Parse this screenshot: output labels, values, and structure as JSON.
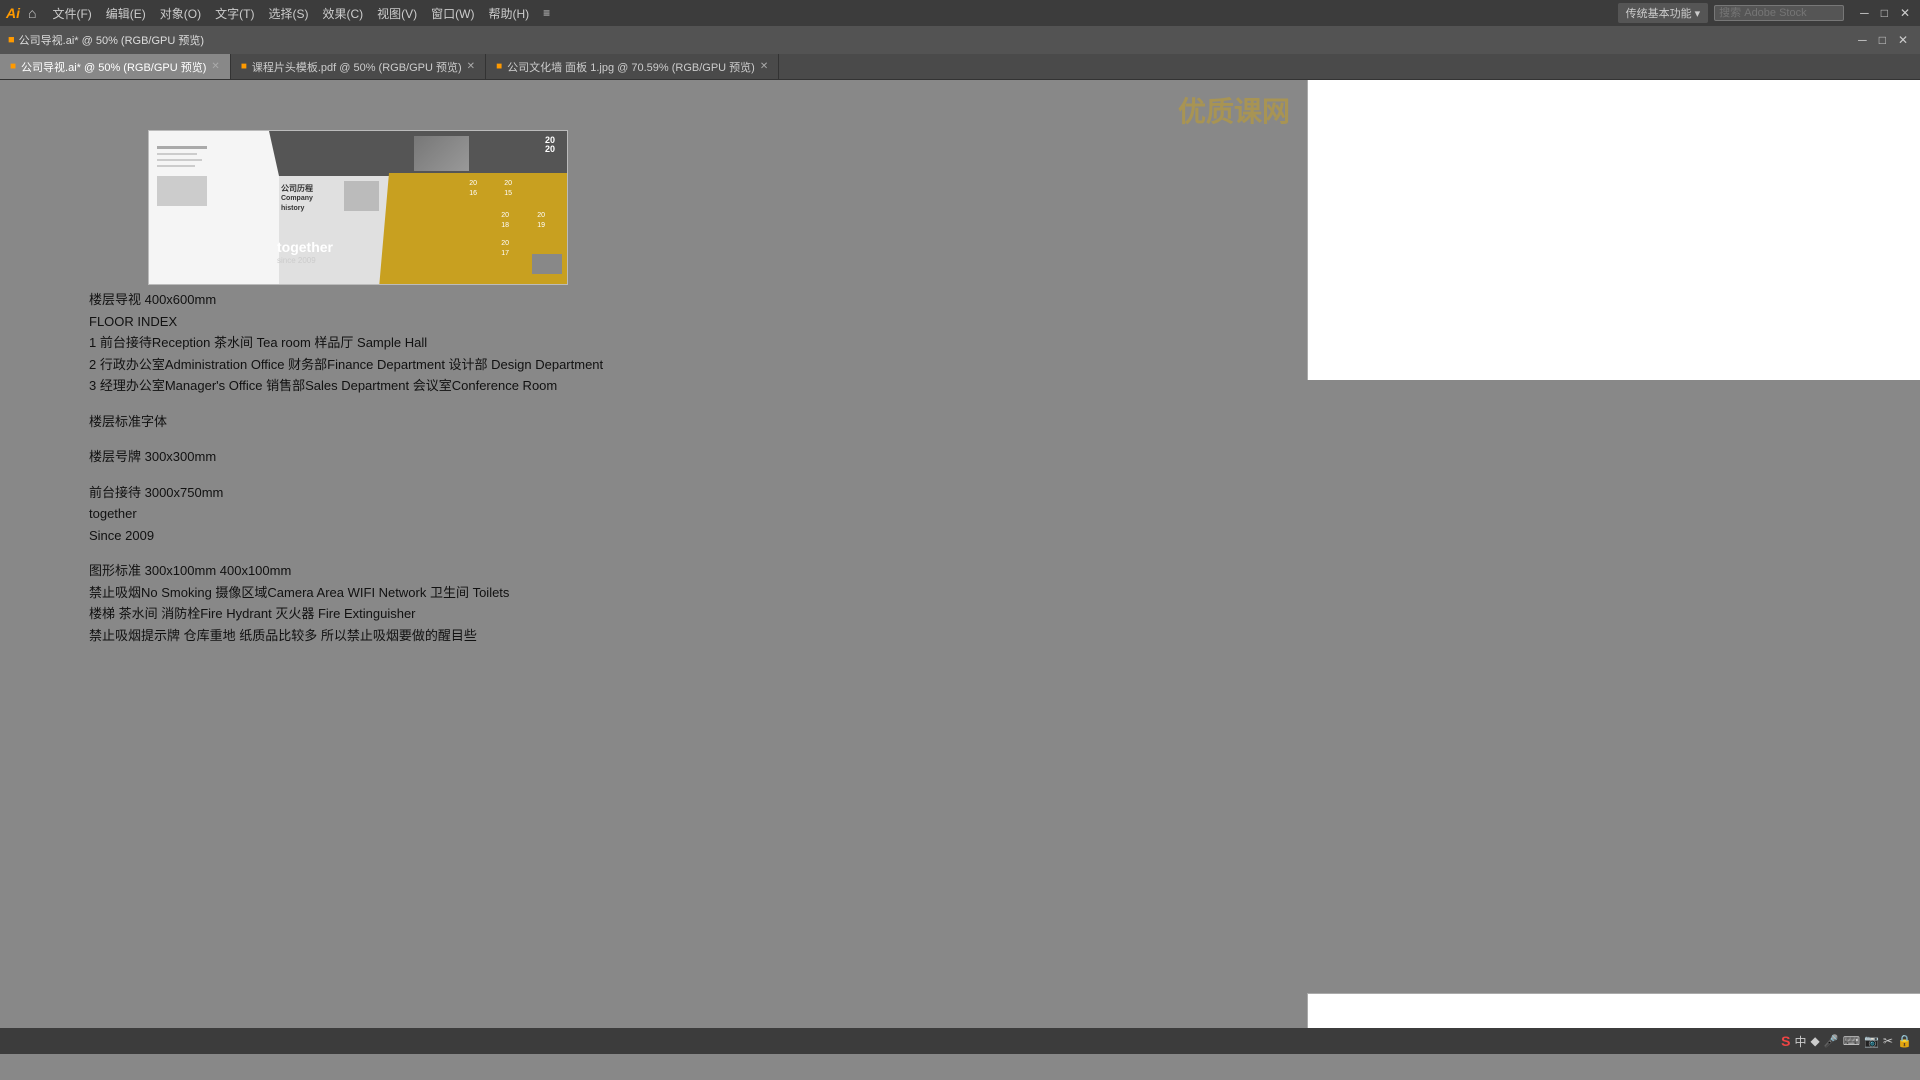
{
  "app": {
    "logo": "Ai",
    "home_icon": "⌂"
  },
  "menubar": {
    "items": [
      {
        "label": "文件(F)"
      },
      {
        "label": "编辑(E)"
      },
      {
        "label": "对象(O)"
      },
      {
        "label": "文字(T)"
      },
      {
        "label": "选择(S)"
      },
      {
        "label": "效果(C)"
      },
      {
        "label": "视图(V)"
      },
      {
        "label": "窗口(W)"
      },
      {
        "label": "帮助(H)"
      },
      {
        "label": "≡"
      }
    ],
    "top_right": {
      "chuantong": "传统基本功能 ▾",
      "search_placeholder": "搜索 Adobe Stock"
    }
  },
  "doc_titlebar": {
    "title": "公司导视.ai* @ 50% (RGB/GPU 预览)",
    "icon": "■"
  },
  "tabs": [
    {
      "label": "公司导视.ai* @ 50% (RGB/GPU 预览)",
      "active": true
    },
    {
      "label": "课程片头模板.pdf @ 50% (RGB/GPU 预览)",
      "active": false
    },
    {
      "label": "公司文化墙 面板 1.jpg @ 70.59% (RGB/GPU 预览)",
      "active": false
    }
  ],
  "content": {
    "floor_guide_title": "楼层导视 400x600mm",
    "floor_index_label": "FLOOR INDEX",
    "floor_lines": [
      "1  前台接待Reception  茶水间 Tea room 样品厅 Sample Hall",
      "2 行政办公室Administration Office 财务部Finance Department 设计部 Design Department",
      "3 经理办公室Manager's Office 销售部Sales Department 会议室Conference Room"
    ],
    "floor_font_label": "楼层标准字体",
    "floor_sign_label": "楼层号牌 300x300mm",
    "reception_label": "前台接待 3000x750mm",
    "together_text": "together",
    "since_text": "Since 2009",
    "graphic_label": "图形标准 300x100mm  400x100mm",
    "graphic_lines": [
      "禁止吸烟No Smoking 摄像区域Camera Area WIFI Network 卫生间 Toilets",
      "楼梯 茶水间 消防栓Fire Hydrant 灭火器 Fire Extinguisher",
      "禁止吸烟提示牌 仓库重地 纸质品比较多 所以禁止吸烟要做的醒目些"
    ]
  },
  "preview": {
    "company_history_cn": "公司历程",
    "company_history_en": "Company history",
    "together": "together",
    "since": "since 2009",
    "years": [
      "2020",
      "2016",
      "2019",
      "2018",
      "2017",
      "2015"
    ]
  },
  "status_bar": {
    "icons": [
      "S",
      "中",
      "♦",
      "🎤",
      "⌨",
      "📷",
      "✂",
      "🔒"
    ]
  }
}
